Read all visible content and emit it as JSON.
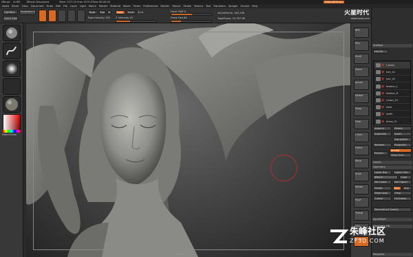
{
  "titlebar": {
    "app": "ZBrush",
    "version": "4.0R5",
    "doc": "ZBrush Document",
    "stats": "Mem 1727.15  Free 1974  ZTime 00:00:00",
    "right": "DefaultZScript"
  },
  "menubar": {
    "items": [
      "Alpha",
      "Brush",
      "Color",
      "Document",
      "Draw",
      "Edit",
      "File",
      "Layer",
      "Light",
      "Macro",
      "Marker",
      "Material",
      "Movie",
      "Picker",
      "Preferences",
      "Render",
      "Stencil",
      "Stroke",
      "Texture",
      "Tool",
      "Transform",
      "Zplugin",
      "Zscript",
      "Help"
    ]
  },
  "toolbar": {
    "lightbox": "LightBox",
    "projection_master": "Projection Master",
    "quicksketch": "Quick Sketch",
    "edit": "Edit",
    "draw": "Draw",
    "move": "Move",
    "scale": "Scale",
    "rotate": "Rotate",
    "mrgb": "Mrgb",
    "rgb": "Rgb",
    "m": "M",
    "zadd": "Zadd",
    "zsub": "Zsub",
    "zcut": "Zcut",
    "rgb_intensity": "Rgb Intensity 100",
    "z_intensity": "Z Intensity 25",
    "focal_shift": "Focal Shift 0",
    "draw_size": "Draw Size 64",
    "active_points": "ActivePoints: 182,248",
    "total_points": "TotalPoints: 19.787 Mil"
  },
  "leftshelf": {
    "color_label": "SwitchColor",
    "buttons": [
      "standard-brush",
      "freehand-stroke",
      "alpha-off",
      "texture-off",
      "material-skin"
    ]
  },
  "rightshelf": {
    "buttons": [
      "BPR",
      "SPix",
      "Scroll",
      "Zoom",
      "Actual",
      "AAHalf",
      "Persp",
      "Floor",
      "L.Sym",
      "Frame",
      "Move",
      "Scale",
      "Rotate",
      "PolyF",
      "Transp",
      "Solo",
      "Xpose"
    ]
  },
  "tray": {
    "subtool_header": "SubTool",
    "list_all": "List All",
    "subtools": [
      "f_body",
      "hair_01",
      "hair_02",
      "feather_L",
      "feather_R",
      "crown_01",
      "eyes",
      "teeth",
      "dress_01"
    ],
    "buttons": {
      "append": "Append",
      "delete": "Delete",
      "duplicate": "Duplicate",
      "insert": "Insert",
      "groupsplit": "GroupSplit",
      "remesh": "Remesh",
      "project_all": "ProjectAll",
      "extract": "Extract",
      "accept": "Accept",
      "thick": "Thick 0.02"
    },
    "layers_header": "Layers",
    "geometry_header": "Geometry",
    "lower_res": "Lower Res",
    "higher_res": "Higher Res",
    "sdiv": "SDiv 6",
    "cage": "Cage",
    "del_lower": "Del Lower",
    "del_higher": "Del Higher",
    "divide": "Divide",
    "smt": "Smt",
    "suv": "Suv",
    "edge_loop": "Edge Loop",
    "crisp": "Crisp",
    "crease": "Crease",
    "uncrease": "UnCrease",
    "reconstruct": "Reconstruct Subdiv",
    "dynamesh": "DynaMesh",
    "hd_geometry": "Geometry HD",
    "polypaint": "Polypaint"
  },
  "canvas": {
    "status": "— 3D Edit —"
  },
  "watermarks": {
    "top": "火星时代",
    "top_url": "www.hxsd.com",
    "bottom_cn": "朱峰社区",
    "bottom_url": "ZF3D.COM"
  }
}
